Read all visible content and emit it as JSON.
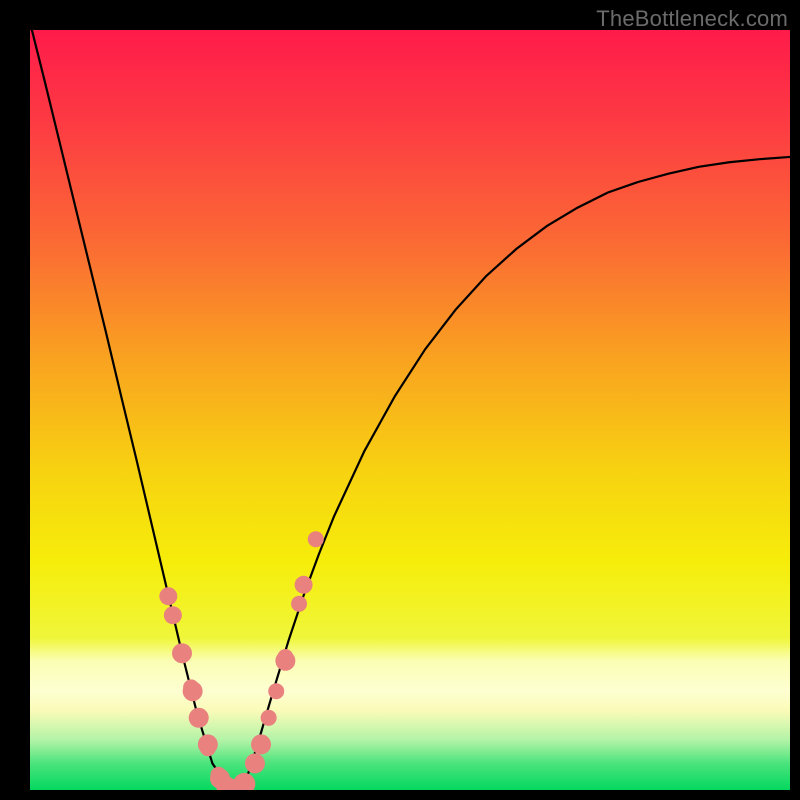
{
  "watermark": "TheBottleneck.com",
  "colors": {
    "frame": "#000000",
    "curve": "#000000",
    "marker_fill": "#e9817f",
    "marker_stroke": "#d46a68",
    "gradient_stops": [
      {
        "offset": 0.0,
        "color": "#fe1b4a"
      },
      {
        "offset": 0.12,
        "color": "#fd3a43"
      },
      {
        "offset": 0.28,
        "color": "#fb6a34"
      },
      {
        "offset": 0.44,
        "color": "#f9a51f"
      },
      {
        "offset": 0.58,
        "color": "#f7d211"
      },
      {
        "offset": 0.7,
        "color": "#f6ed0a"
      },
      {
        "offset": 0.8,
        "color": "#eff63a"
      },
      {
        "offset": 0.83,
        "color": "#fbfeb3"
      },
      {
        "offset": 0.87,
        "color": "#fdffd1"
      },
      {
        "offset": 0.895,
        "color": "#fbfbb8"
      },
      {
        "offset": 0.935,
        "color": "#b1f3a6"
      },
      {
        "offset": 0.965,
        "color": "#4be47c"
      },
      {
        "offset": 1.0,
        "color": "#04d85f"
      }
    ]
  },
  "chart_data": {
    "type": "line",
    "x": [
      0.0,
      0.02,
      0.04,
      0.06,
      0.08,
      0.1,
      0.12,
      0.14,
      0.16,
      0.18,
      0.2,
      0.22,
      0.24,
      0.26,
      0.265,
      0.27,
      0.275,
      0.28,
      0.285,
      0.29,
      0.3,
      0.32,
      0.34,
      0.36,
      0.38,
      0.4,
      0.44,
      0.48,
      0.52,
      0.56,
      0.6,
      0.64,
      0.68,
      0.72,
      0.76,
      0.8,
      0.84,
      0.88,
      0.92,
      0.96,
      1.0
    ],
    "y": [
      101,
      93.0,
      84.8,
      76.6,
      68.4,
      60.2,
      51.8,
      43.5,
      35.0,
      26.5,
      18.0,
      10.0,
      3.5,
      0.6,
      0.2,
      0.0,
      0.2,
      0.6,
      1.6,
      3.0,
      6.2,
      13.0,
      19.6,
      25.6,
      31.0,
      36.0,
      44.6,
      51.8,
      58.0,
      63.2,
      67.6,
      71.2,
      74.2,
      76.6,
      78.6,
      80.0,
      81.1,
      82.0,
      82.6,
      83.0,
      83.3
    ],
    "xlim": [
      0,
      1
    ],
    "ylim": [
      0,
      100
    ],
    "markers": {
      "x": [
        0.182,
        0.188,
        0.2,
        0.214,
        0.212,
        0.222,
        0.234,
        0.234,
        0.248,
        0.25,
        0.258,
        0.268,
        0.282,
        0.296,
        0.304,
        0.314,
        0.324,
        0.336,
        0.336,
        0.354,
        0.36,
        0.376
      ],
      "y": [
        25.5,
        23.0,
        18.0,
        13.0,
        13.5,
        9.5,
        5.5,
        6.0,
        2.0,
        1.5,
        0.5,
        0.0,
        0.8,
        3.5,
        6.0,
        9.5,
        13.0,
        17.0,
        17.5,
        24.5,
        27.0,
        33.0
      ],
      "r": [
        9,
        9,
        10,
        10,
        8,
        10,
        8,
        10,
        8,
        10,
        10,
        11,
        11,
        10,
        10,
        8,
        8,
        10,
        8,
        8,
        9,
        8
      ]
    },
    "title": "",
    "xlabel": "",
    "ylabel": ""
  }
}
